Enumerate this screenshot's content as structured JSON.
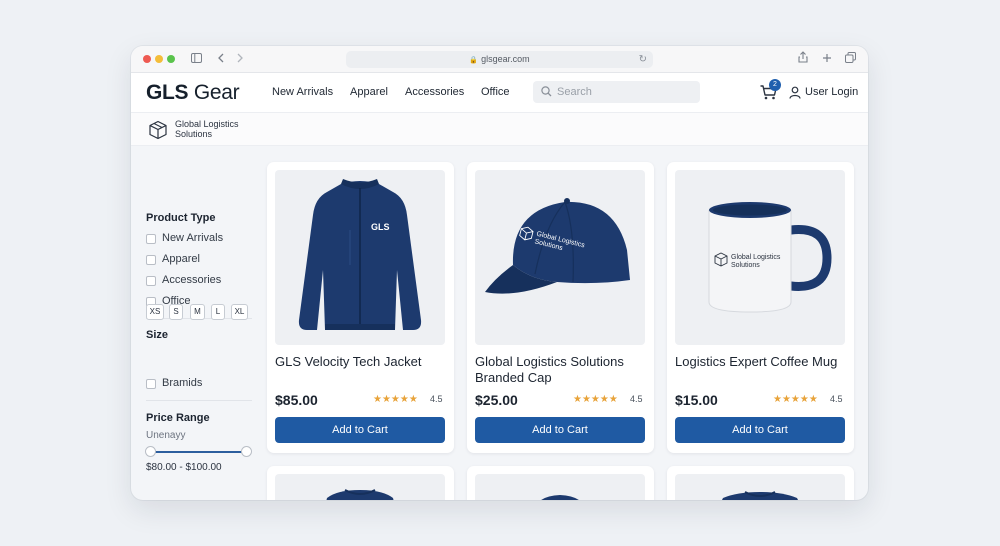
{
  "browser": {
    "url": "glsgear.com",
    "controls": [
      "sidebar-icon",
      "back-icon",
      "forward-icon",
      "share-icon",
      "new-tab-icon",
      "tabs-icon"
    ]
  },
  "header": {
    "logo_bold": "GLS",
    "logo_light": "Gear",
    "nav": [
      "New Arrivals",
      "Apparel",
      "Accessories",
      "Office"
    ],
    "search_placeholder": "Search",
    "cart_count": "2",
    "user_label": "User Login"
  },
  "brand": {
    "name_line1": "Global Logistics",
    "name_line2": "Solutions"
  },
  "filters": {
    "product_type_title": "Product Type",
    "product_types": [
      "New Arrivals",
      "Apparel",
      "Accessories",
      "Office"
    ],
    "size_title": "Size",
    "sizes": [
      "XS",
      "S",
      "M",
      "L",
      "XL"
    ],
    "extra_option": "Bramids",
    "price_title": "Price Range",
    "price_sub": "Unenayy",
    "price_value": "$80.00 - $100.00"
  },
  "products": [
    {
      "title": "GLS Velocity Tech Jacket",
      "price": "$85.00",
      "stars": "★★★★★",
      "rating": "4.5",
      "button": "Add to Cart",
      "print": "GLS"
    },
    {
      "title": "Global Logistics Solutions Branded Cap",
      "price": "$25.00",
      "stars": "★★★★★",
      "rating": "4.5",
      "button": "Add to Cart",
      "print_line1": "Global Logistics",
      "print_line2": "Solutions"
    },
    {
      "title": "Logistics Expert Coffee Mug",
      "price": "$15.00",
      "stars": "★★★★★",
      "rating": "4.5",
      "button": "Add to Cart",
      "print_line1": "Global Logistics",
      "print_line2": "Solutions"
    }
  ],
  "colors": {
    "accent": "#1f5aa3",
    "navy_product": "#1d3a6e",
    "star": "#e8a33a"
  }
}
